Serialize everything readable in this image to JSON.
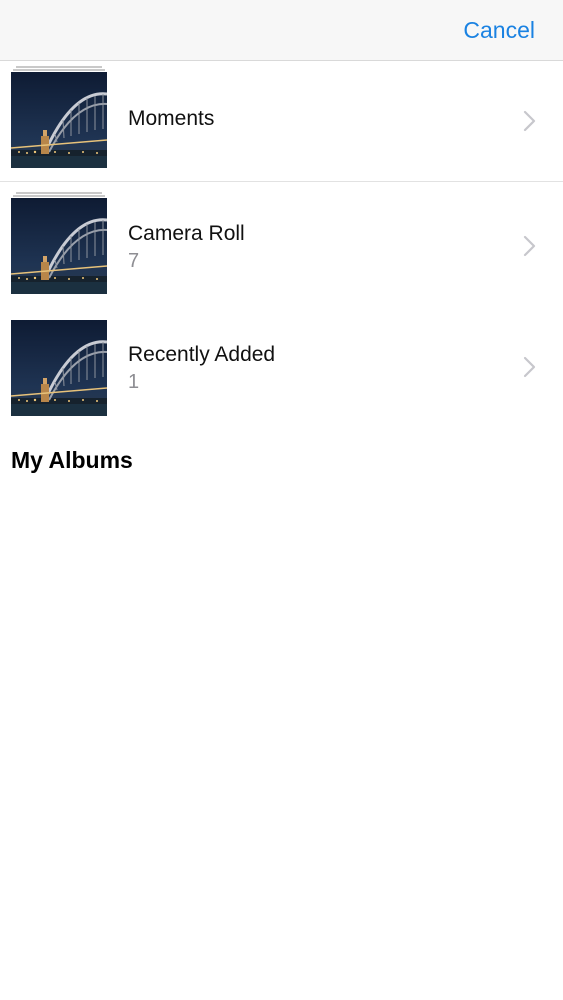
{
  "navbar": {
    "cancel_label": "Cancel"
  },
  "albums": [
    {
      "title": "Moments",
      "count": "",
      "thumbnail": "bridge-night-photo"
    },
    {
      "title": "Camera Roll",
      "count": "7",
      "thumbnail": "bridge-night-photo"
    },
    {
      "title": "Recently Added",
      "count": "1",
      "thumbnail": "bridge-night-photo"
    }
  ],
  "sections": {
    "my_albums_title": "My Albums"
  },
  "colors": {
    "accent": "#1a82e2",
    "secondary_text": "#8e8e93",
    "navbar_bg": "#f7f7f7"
  },
  "icons": {
    "disclosure": "chevron-right-icon"
  }
}
